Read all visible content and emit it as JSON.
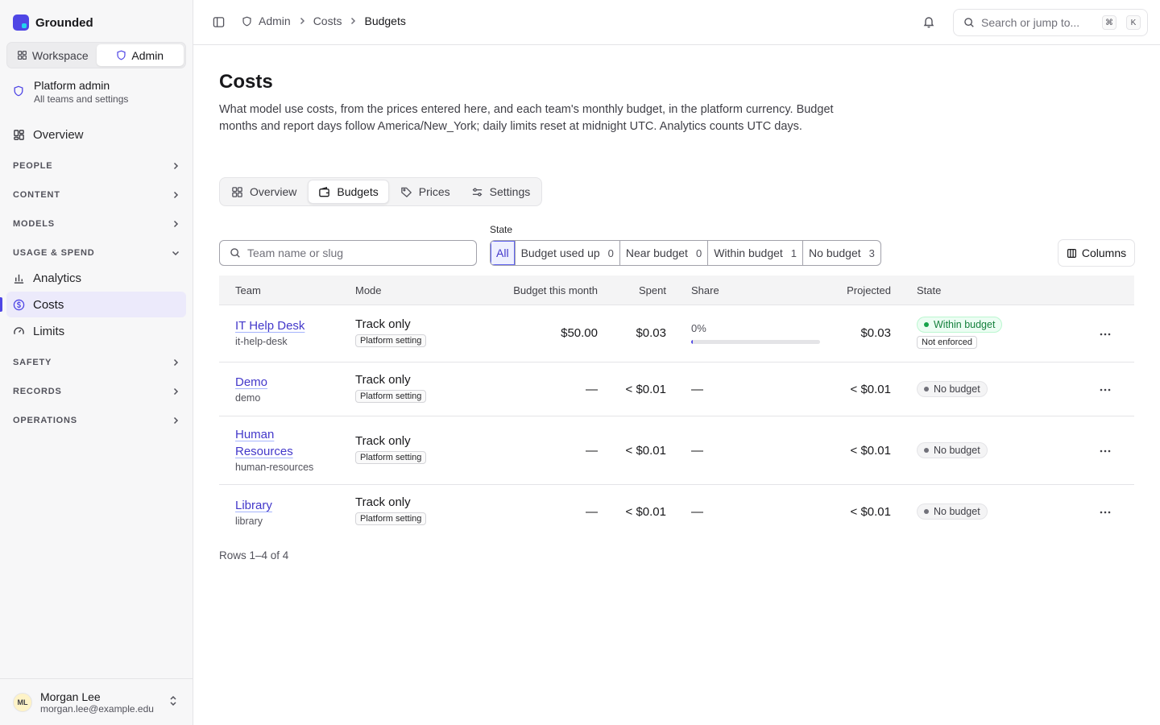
{
  "app": {
    "name": "Grounded"
  },
  "switcher": {
    "workspace": "Workspace",
    "admin": "Admin"
  },
  "context": {
    "title": "Platform admin",
    "subtitle": "All teams and settings"
  },
  "nav": {
    "overview": "Overview",
    "sections": {
      "people": "PEOPLE",
      "content": "CONTENT",
      "models": "MODELS",
      "usage": "USAGE & SPEND",
      "safety": "SAFETY",
      "records": "RECORDS",
      "operations": "OPERATIONS"
    },
    "usage_items": {
      "analytics": "Analytics",
      "costs": "Costs",
      "limits": "Limits"
    }
  },
  "user": {
    "initials": "ML",
    "name": "Morgan Lee",
    "email": "morgan.lee@example.edu"
  },
  "breadcrumb": {
    "admin": "Admin",
    "costs": "Costs",
    "budgets": "Budgets"
  },
  "search": {
    "placeholder": "Search or jump to...",
    "kbd1": "⌘",
    "kbd2": "K"
  },
  "page": {
    "title": "Costs",
    "description": "What model use costs, from the prices entered here, and each team's monthly budget, in the platform currency. Budget months and report days follow America/New_York; daily limits reset at midnight UTC. Analytics counts UTC days."
  },
  "tabs": {
    "overview": "Overview",
    "budgets": "Budgets",
    "prices": "Prices",
    "settings": "Settings"
  },
  "filters": {
    "placeholder": "Team name or slug",
    "state_label": "State",
    "states": [
      {
        "label": "All",
        "count": ""
      },
      {
        "label": "Budget used up",
        "count": "0"
      },
      {
        "label": "Near budget",
        "count": "0"
      },
      {
        "label": "Within budget",
        "count": "1"
      },
      {
        "label": "No budget",
        "count": "3"
      }
    ],
    "columns_label": "Columns"
  },
  "table": {
    "headers": {
      "team": "Team",
      "mode": "Mode",
      "budget": "Budget this month",
      "spent": "Spent",
      "share": "Share",
      "projected": "Projected",
      "state": "State"
    },
    "rows": [
      {
        "team": "IT Help Desk",
        "slug": "it-help-desk",
        "mode": "Track only",
        "mode_tag": "Platform setting",
        "budget": "$50.00",
        "spent": "$0.03",
        "share": "0%",
        "share_fraction": 0.0006,
        "projected": "$0.03",
        "state": "Within budget",
        "state_note": "Not enforced"
      },
      {
        "team": "Demo",
        "slug": "demo",
        "mode": "Track only",
        "mode_tag": "Platform setting",
        "budget": "—",
        "spent": "< $0.01",
        "share": "—",
        "projected": "< $0.01",
        "state": "No budget"
      },
      {
        "team": "Human Resources",
        "slug": "human-resources",
        "mode": "Track only",
        "mode_tag": "Platform setting",
        "budget": "—",
        "spent": "< $0.01",
        "share": "—",
        "projected": "< $0.01",
        "state": "No budget"
      },
      {
        "team": "Library",
        "slug": "library",
        "mode": "Track only",
        "mode_tag": "Platform setting",
        "budget": "—",
        "spent": "< $0.01",
        "share": "—",
        "projected": "< $0.01",
        "state": "No budget"
      }
    ],
    "footer": "Rows 1–4 of 4"
  },
  "colors": {
    "accent": "#4f46e5",
    "success": "#16a34a",
    "link": "#4338ca"
  }
}
